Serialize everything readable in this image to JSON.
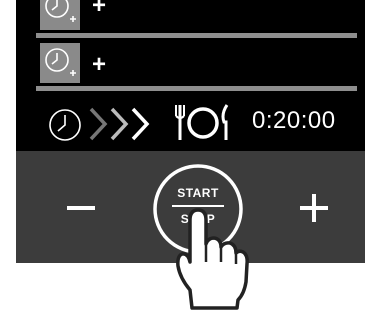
{
  "timer_rows": [
    {
      "icon": "timer-icon",
      "add_label": "+"
    },
    {
      "icon": "timer-icon",
      "add_label": "+"
    }
  ],
  "status": {
    "clock_icon": "clock-icon",
    "progress_icon": "chevrons-right-icon",
    "meal_icon": "plate-cutlery-icon",
    "time": "0:20:00"
  },
  "controls": {
    "minus_icon": "minus-icon",
    "plus_icon": "plus-icon",
    "start_label": "START",
    "stop_label": "STOP",
    "hand_icon": "pointing-hand-icon"
  },
  "colors": {
    "screen": "#000000",
    "panel": "#3c3c3c",
    "row_separator": "#8e8e8e",
    "foreground": "#ffffff"
  }
}
